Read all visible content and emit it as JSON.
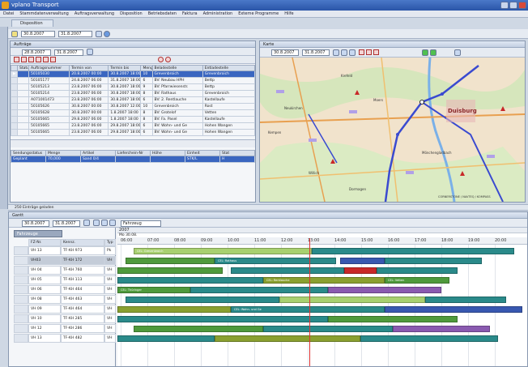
{
  "window": {
    "title": "vplano Transport"
  },
  "menu": [
    "Datei",
    "Stammdatenverwaltung",
    "Auftragsverwaltung",
    "Disposition",
    "Betriebsdaten",
    "Faktura",
    "Administration",
    "Externe Programme",
    "Hilfe"
  ],
  "disposition_tab": "Disposition",
  "date_range": {
    "from": "30.8.2007",
    "to": "31.8.2007"
  },
  "orders_panel": {
    "title": "Aufträge",
    "date_from": "28.8.2007",
    "date_to": "31.8.2007",
    "columns": [
      "Status",
      "Auftragsnummer",
      "Termin von",
      "Termin bis",
      "Menge",
      "Beladestelle",
      "Entladestelle"
    ],
    "rows": [
      [
        "",
        "50105030",
        "20.8.2007 00:00",
        "30.8.2007 18:00",
        "10",
        "Grevenbroich",
        "Grevenbroich"
      ],
      [
        "",
        "50105177",
        "24.8.2007 06:00",
        "31.8.2007 18:00",
        "6",
        "BV: Neubau HPH",
        "Bettp"
      ],
      [
        "",
        "50105213",
        "23.8.2007 06:00",
        "30.8.2007 18:00",
        "9",
        "BV: Pfarrwiesenstr.",
        "Bettp"
      ],
      [
        "",
        "50105214",
        "23.8.2007 06:00",
        "30.8.2007 18:00",
        "8",
        "BV: Rathaus",
        "Grevenbroich"
      ],
      [
        "",
        "A071001473",
        "23.8.2007 06:00",
        "30.8.2007 18:00",
        "6",
        "BV: 2. Rentlauche",
        "Kastellaufe"
      ],
      [
        "",
        "50105626",
        "30.8.2007 00:00",
        "30.8.2007 12:00",
        "10",
        "Grevenbroich",
        "Rost"
      ],
      [
        "",
        "50105628",
        "30.8.2007 00:00",
        "1.8.2007 18:00",
        "8",
        "BV: Grotelof",
        "Vetten"
      ],
      [
        "",
        "50105665",
        "29.8.2007 06:00",
        "1.8.2007 18:00",
        "8",
        "BV: Fa. Pasel",
        "Kastellaufe"
      ],
      [
        "",
        "50105665",
        "23.8.2007 06:00",
        "29.8.2007 18:00",
        "6",
        "BV: Wohn- und Ge",
        "Hohen Wangen"
      ],
      [
        "",
        "50105665",
        "23.8.2007 06:00",
        "29.8.2007 18:00",
        "6",
        "BV: Wohn- und Ge",
        "Hohen Wangen"
      ]
    ],
    "lower_columns": [
      "Sendungsstatus",
      "Menge",
      "Artikel",
      "Lieferchein-Nr",
      "Höhe",
      "Einheit",
      "Stat"
    ],
    "lower_row": [
      "Geplant",
      "70,000",
      "Sand 0/4",
      "",
      "",
      "STK/L",
      "H"
    ]
  },
  "map_panel": {
    "title": "Karte",
    "date_from": "30.8.2007",
    "date_to": "31.8.2007",
    "city": "Duisburg",
    "places": [
      "Krefeld",
      "Moers",
      "Neukirchen",
      "Kempen",
      "Willich",
      "Mönchengladbach",
      "Dormagen"
    ],
    "copyright": "CORNERSTONE / NAVTEQ / KOMPASS"
  },
  "statusline": "250 Einträge geladen",
  "gantt": {
    "title": "Gantt",
    "date_from": "30.8.2007",
    "date_to": "31.8.2007",
    "vehicle_filter": "Fahrzeug",
    "year": "2007",
    "date_label": "Mo 30.08.",
    "hours": [
      "06:00",
      "07:00",
      "08:00",
      "09:00",
      "10:00",
      "11:00",
      "12:00",
      "13:00",
      "14:00",
      "15:00",
      "16:00",
      "17:00",
      "18:00",
      "19:00",
      "20:00"
    ],
    "group_label": "Fahrzeuge",
    "columns": [
      "FZ-Nr.",
      "Kennz.",
      "Typ"
    ],
    "rows": [
      [
        "VH 13",
        "TF-KH 973",
        "Pk"
      ],
      [
        "VH03",
        "TF-KH 172",
        "VH"
      ],
      [
        "VH 04",
        "TF-KH 760",
        "VH"
      ],
      [
        "VH 05",
        "TF-KH 113",
        "VH"
      ],
      [
        "VH 06",
        "TF-KH 464",
        "VH"
      ],
      [
        "VH 08",
        "TF-KH 463",
        "VH"
      ],
      [
        "VH 09",
        "TF-KH 464",
        "VH"
      ],
      [
        "VH 10",
        "TF-KH 285",
        "VH"
      ],
      [
        "VH 12",
        "TF-KH 286",
        "VH"
      ],
      [
        "VH 13",
        "TF-KH 482",
        "VH"
      ]
    ],
    "bar_labels": [
      "CEL: Grevenbroich",
      "CEL: Rathaus",
      "CEL: Fa. Pasel",
      "CEL: Rentlauche",
      "CEL: Vetten",
      "CEL: Thüringer",
      "CEL: Wohn- und Ge"
    ]
  },
  "colors": {
    "bar_green": "#4f9a3c",
    "bar_teal": "#2a8a8a",
    "bar_blue": "#3858b0",
    "bar_red": "#c82828",
    "bar_purple": "#8a5ab0",
    "bar_olive": "#8aa030",
    "bar_light": "#a8d070",
    "now_line": "#e03030",
    "route": "#3a4ad0"
  }
}
